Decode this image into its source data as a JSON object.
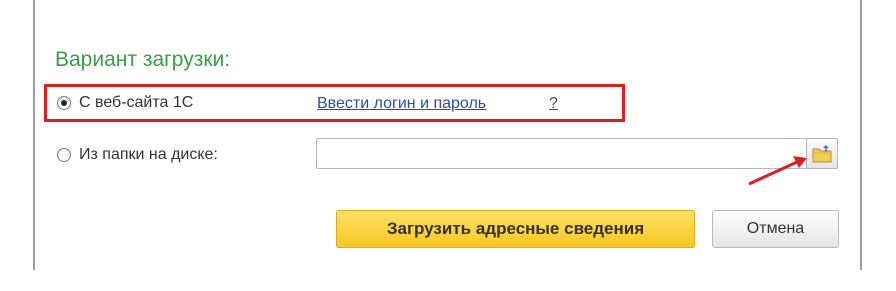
{
  "section": {
    "title": "Вариант загрузки:"
  },
  "options": {
    "web": {
      "label": "С веб-сайта 1С",
      "selected": true
    },
    "folder": {
      "label": "Из папки на диске:",
      "selected": false
    }
  },
  "links": {
    "login": "Ввести логин и пароль",
    "help": "?"
  },
  "path_input": {
    "value": "",
    "placeholder": ""
  },
  "buttons": {
    "load": "Загрузить адресные сведения",
    "cancel": "Отмена",
    "folder_icon": "folder-open-icon"
  },
  "colors": {
    "title": "#3a9e47",
    "link": "#2c4ca8",
    "highlight": "#e02020",
    "primary_button": "#f6c823"
  }
}
